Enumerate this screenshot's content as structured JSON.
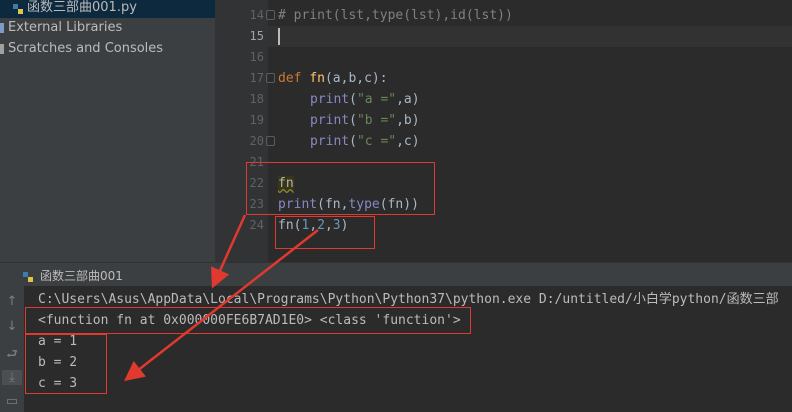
{
  "project_tree": {
    "items": [
      {
        "label": "函数三部曲001.py"
      },
      {
        "label": "External Libraries"
      },
      {
        "label": "Scratches and Consoles"
      }
    ]
  },
  "editor": {
    "line_numbers": [
      "14",
      "15",
      "16",
      "17",
      "18",
      "19",
      "20",
      "21",
      "22",
      "23",
      "24"
    ],
    "lines": {
      "l14": "# print(lst,type(lst),id(lst))",
      "l17_kw": "def ",
      "l17_name": "fn",
      "l17_rest": "(a,b,c):",
      "l18_fn": "print",
      "l18_str": "\"a =\"",
      "l18_rest": ",a)",
      "l19_fn": "print",
      "l19_str": "\"b =\"",
      "l19_rest": ",b)",
      "l20_fn": "print",
      "l20_str": "\"c =\"",
      "l20_rest": ",c)",
      "l22": "fn",
      "l23_fn": "print",
      "l23_a": "(fn,",
      "l23_type": "type",
      "l23_b": "(fn))",
      "l24_a": "fn(",
      "l24_n1": "1",
      "l24_c1": ",",
      "l24_n2": "2",
      "l24_c2": ",",
      "l24_n3": "3",
      "l24_b": ")"
    }
  },
  "run_panel": {
    "tab_label": "函数三部曲001",
    "console_lines": [
      "C:\\Users\\Asus\\AppData\\Local\\Programs\\Python\\Python37\\python.exe D:/untitled/小白学python/函数三部",
      "<function fn at 0x000000FE6B7AD1E0> <class 'function'>",
      "a = 1",
      "b = 2",
      "c = 3"
    ]
  },
  "colors": {
    "annotation_red": "#e0392f",
    "keyword": "#cc7832",
    "string": "#6a8759",
    "number": "#6897bb"
  }
}
